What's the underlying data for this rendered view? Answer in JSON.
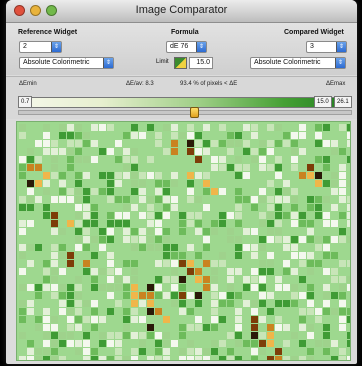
{
  "window": {
    "title": "Image Comparator"
  },
  "reference": {
    "label": "Reference Widget",
    "index": "2",
    "intent": "Absolute Colorimetric"
  },
  "formula": {
    "label": "Formula",
    "value": "dE 76",
    "limit_label": "Limit",
    "limit_value": "15.0"
  },
  "compared": {
    "label": "Compared Widget",
    "index": "3",
    "intent": "Absolute Colorimetric"
  },
  "stats": {
    "min_label": "ΔEmin",
    "max_label": "ΔEmax",
    "avg": "ΔE/av: 8.3",
    "pct": "93.4 % of pixels < ΔE",
    "min_value": "0.7",
    "max_value": "15.0",
    "max_box": "26.1",
    "slider_fraction": 0.53
  },
  "colors": {
    "background_green": "#9ed88f",
    "cell_palette": [
      "#f4f8ee",
      "#e3f0d8",
      "#c8e5b8",
      "#9fd28c",
      "#6dbb5b",
      "#3f9b35",
      "#1f7a1f",
      "#f0b64a",
      "#c98320",
      "#7d3d08",
      "#2a1a08"
    ]
  }
}
